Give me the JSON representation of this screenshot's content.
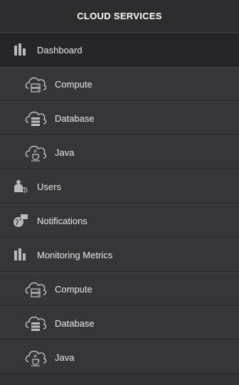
{
  "header": {
    "title": "CLOUD SERVICES"
  },
  "menu": {
    "dashboard": {
      "label": "Dashboard",
      "icon": "bar-chart-icon"
    },
    "dashboard_sub": [
      {
        "label": "Compute",
        "icon": "cloud-server-icon"
      },
      {
        "label": "Database",
        "icon": "cloud-database-icon"
      },
      {
        "label": "Java",
        "icon": "cloud-java-icon"
      }
    ],
    "users": {
      "label": "Users",
      "icon": "user-info-icon"
    },
    "notifications": {
      "label": "Notifications",
      "icon": "globe-chat-icon"
    },
    "monitoring": {
      "label": "Monitoring Metrics",
      "icon": "bar-chart-icon"
    },
    "monitoring_sub": [
      {
        "label": "Compute",
        "icon": "cloud-server-icon"
      },
      {
        "label": "Database",
        "icon": "cloud-database-icon"
      },
      {
        "label": "Java",
        "icon": "cloud-java-icon"
      }
    ]
  },
  "colors": {
    "background": "#343436",
    "active": "#262628",
    "icon": "#b9b9b9",
    "text": "#eaeaea"
  }
}
